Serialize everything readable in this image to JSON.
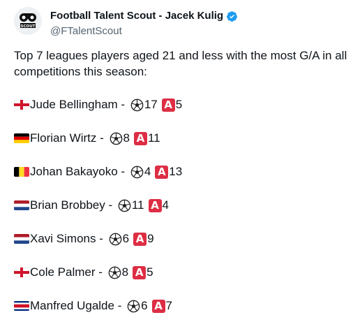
{
  "author": {
    "display_name": "Football Talent Scout - Jacek Kulig",
    "handle": "@FTalentScout",
    "avatar_text": "SCOUT",
    "avatar_icon": "scout-logo-icon",
    "verified_icon": "verified-badge-icon"
  },
  "tweet": {
    "text": "Top 7 leagues players aged 21 and less with the most G/A in all competitions this season:"
  },
  "players": [
    {
      "flag": "england",
      "name": "Jude Bellingham",
      "sep": " - ",
      "goals": "17",
      "assist_glyph": "A",
      "assists": "5"
    },
    {
      "flag": "germany",
      "name": "Florian Wirtz",
      "sep": " - ",
      "goals": "8",
      "assist_glyph": "A",
      "assists": "11"
    },
    {
      "flag": "belgium",
      "name": "Johan Bakayoko",
      "sep": " - ",
      "goals": "4",
      "assist_glyph": "A",
      "assists": "13"
    },
    {
      "flag": "netherlands",
      "name": "Brian Brobbey",
      "sep": " - ",
      "goals": "11",
      "assist_glyph": "A",
      "assists": "4"
    },
    {
      "flag": "netherlands",
      "name": "Xavi Simons",
      "sep": " - ",
      "goals": "6",
      "assist_glyph": "A",
      "assists": "9"
    },
    {
      "flag": "england",
      "name": "Cole Palmer",
      "sep": " - ",
      "goals": "8",
      "assist_glyph": "A",
      "assists": "5"
    },
    {
      "flag": "costa-rica",
      "name": "Manfred Ugalde",
      "sep": " - ",
      "goals": "6",
      "assist_glyph": "A",
      "assists": "7"
    }
  ],
  "colors": {
    "text": "#0f1419",
    "secondary": "#536471",
    "verified": "#1d9bf0",
    "assist_badge": "#dd2e44"
  }
}
